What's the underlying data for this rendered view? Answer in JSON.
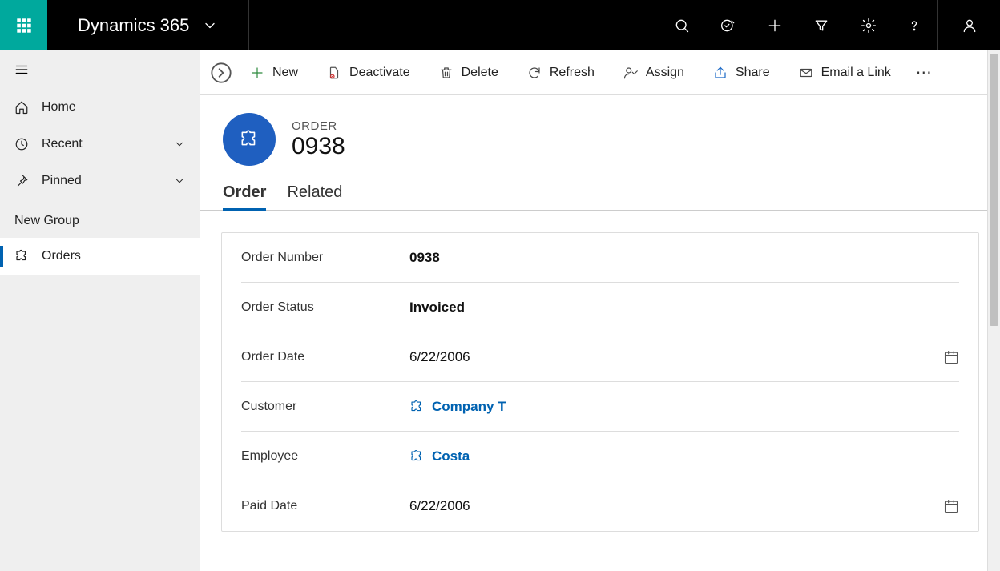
{
  "topbar": {
    "brand": "Dynamics 365"
  },
  "sidebar": {
    "home": "Home",
    "recent": "Recent",
    "pinned": "Pinned",
    "group_label": "New Group",
    "orders": "Orders"
  },
  "cmdbar": {
    "new": "New",
    "deactivate": "Deactivate",
    "delete": "Delete",
    "refresh": "Refresh",
    "assign": "Assign",
    "share": "Share",
    "email": "Email a Link"
  },
  "record": {
    "type_label": "ORDER",
    "title": "0938"
  },
  "tabs": {
    "order": "Order",
    "related": "Related"
  },
  "form": {
    "order_number_label": "Order Number",
    "order_number_value": "0938",
    "order_status_label": "Order Status",
    "order_status_value": "Invoiced",
    "order_date_label": "Order Date",
    "order_date_value": "6/22/2006",
    "customer_label": "Customer",
    "customer_value": "Company T",
    "employee_label": "Employee",
    "employee_value": "Costa",
    "paid_date_label": "Paid Date",
    "paid_date_value": "6/22/2006"
  }
}
